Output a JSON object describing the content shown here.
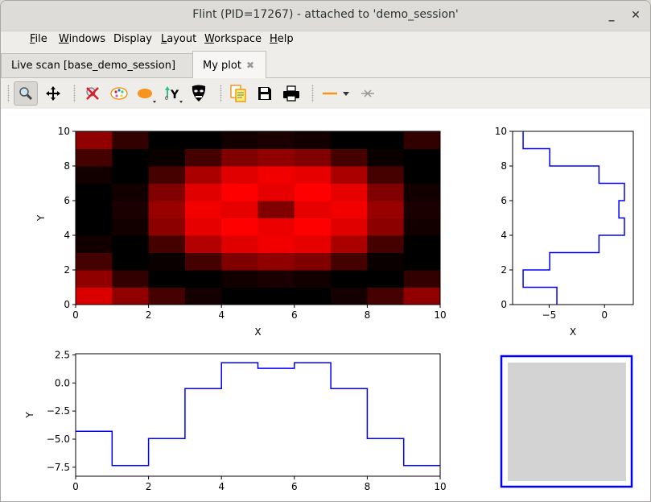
{
  "window": {
    "title": "Flint (PID=17267) - attached to 'demo_session'",
    "minimize_label": "_",
    "close_label": "✕"
  },
  "menu": {
    "items": [
      {
        "label_u": "F",
        "label_rest": "ile"
      },
      {
        "label_u": "W",
        "label_rest": "indows"
      },
      {
        "label_u": "",
        "label_rest": "Display"
      },
      {
        "label_u": "L",
        "label_rest": "ayout"
      },
      {
        "label_u": "W",
        "label_rest": "orkspace"
      },
      {
        "label_u": "H",
        "label_rest": "elp"
      }
    ]
  },
  "tabs": [
    {
      "label": "Live scan [base_demo_session]",
      "active": false
    },
    {
      "label": "My plot",
      "active": true,
      "close_icon": "✖"
    }
  ],
  "toolbar": {
    "tools": [
      "zoom-icon",
      "pan-icon",
      "reset-zoom-icon",
      "colormap-icon",
      "marker-style-icon",
      "y-axis-icon",
      "mask-icon",
      "copy-icon",
      "save-icon",
      "print-icon",
      "line-style-icon",
      "crosshair-icon"
    ]
  },
  "chart_data": [
    {
      "type": "heatmap",
      "name": "image",
      "xlabel": "X",
      "ylabel": "Y",
      "xlim": [
        0,
        10
      ],
      "ylim": [
        0,
        10
      ],
      "xticks": [
        "0",
        "2",
        "4",
        "6",
        "8",
        "10"
      ],
      "yticks": [
        "0",
        "2",
        "4",
        "6",
        "8",
        "10"
      ],
      "colormap": "red",
      "rows_bottom_to_top": [
        [
          0.86,
          0.57,
          0.27,
          0.08,
          0.0,
          0.0,
          0.0,
          0.08,
          0.27,
          0.57
        ],
        [
          0.57,
          0.2,
          0.0,
          0.0,
          0.07,
          0.1,
          0.07,
          0.0,
          0.0,
          0.2
        ],
        [
          0.27,
          0.0,
          0.04,
          0.27,
          0.5,
          0.57,
          0.5,
          0.27,
          0.04,
          0.0
        ],
        [
          0.07,
          0.0,
          0.27,
          0.7,
          0.88,
          0.95,
          0.9,
          0.67,
          0.27,
          0.0
        ],
        [
          0.0,
          0.07,
          0.55,
          0.9,
          1.0,
          0.93,
          1.0,
          0.88,
          0.55,
          0.07
        ],
        [
          0.0,
          0.1,
          0.6,
          0.95,
          0.9,
          0.5,
          0.9,
          0.95,
          0.6,
          0.1
        ],
        [
          0.0,
          0.07,
          0.5,
          0.88,
          1.0,
          0.9,
          1.0,
          0.9,
          0.5,
          0.07
        ],
        [
          0.07,
          0.0,
          0.27,
          0.67,
          0.88,
          0.95,
          0.9,
          0.67,
          0.27,
          0.0
        ],
        [
          0.27,
          0.0,
          0.04,
          0.27,
          0.5,
          0.57,
          0.5,
          0.27,
          0.04,
          0.0
        ],
        [
          0.57,
          0.2,
          0.0,
          0.0,
          0.07,
          0.1,
          0.07,
          0.0,
          0.0,
          0.2
        ]
      ]
    },
    {
      "type": "line",
      "name": "side-histogram",
      "style": "step-vertical",
      "xlabel": "X",
      "ylabel": "",
      "xlim": [
        -8.3,
        2.6
      ],
      "ylim": [
        0,
        10
      ],
      "xticks": [
        {
          "v": -5,
          "label": "−5"
        },
        {
          "v": 0,
          "label": "0"
        }
      ],
      "yticks": [
        "0",
        "2",
        "4",
        "6",
        "8",
        "10"
      ],
      "color": "#0000ff",
      "y_edges": [
        0,
        1,
        2,
        3,
        4,
        5,
        6,
        7,
        8,
        9,
        10
      ],
      "values": [
        -4.3,
        -7.35,
        -4.95,
        -0.5,
        1.8,
        1.3,
        1.8,
        -0.5,
        -4.95,
        -7.35
      ]
    },
    {
      "type": "line",
      "name": "bottom-histogram",
      "style": "step-horizontal",
      "xlabel": "",
      "ylabel": "Y",
      "xlim": [
        0,
        10
      ],
      "ylim": [
        -8.3,
        2.6
      ],
      "xticks": [
        "0",
        "2",
        "4",
        "6",
        "8",
        "10"
      ],
      "yticks": [
        {
          "v": 2.5,
          "label": "2.5"
        },
        {
          "v": 0,
          "label": "0.0"
        },
        {
          "v": -2.5,
          "label": "−2.5"
        },
        {
          "v": -5,
          "label": "−5.0"
        },
        {
          "v": -7.5,
          "label": "−7.5"
        }
      ],
      "color": "#0000ff",
      "x_edges": [
        0,
        1,
        2,
        3,
        4,
        5,
        6,
        7,
        8,
        9,
        10
      ],
      "values": [
        -4.3,
        -7.35,
        -4.95,
        -0.5,
        1.8,
        1.3,
        1.8,
        -0.5,
        -4.95,
        -7.35
      ]
    }
  ],
  "corner_widget": {
    "border_color": "#0000ff",
    "fill_color": "#d3d3d3"
  }
}
